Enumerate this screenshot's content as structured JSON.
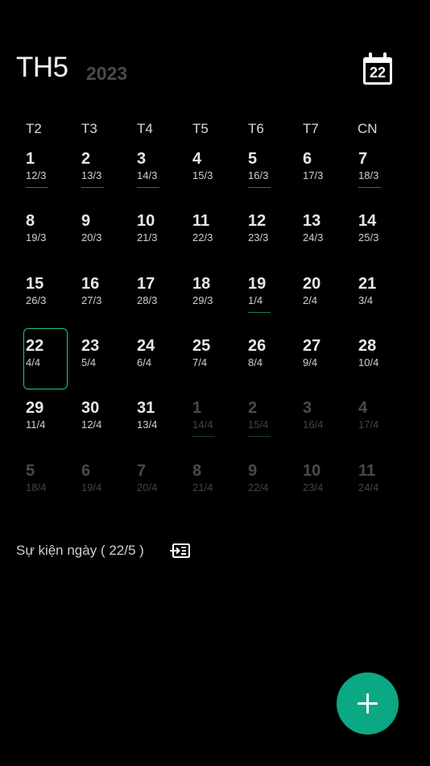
{
  "header": {
    "month": "TH5",
    "year": "2023",
    "today_icon_day": "22"
  },
  "weekdays": [
    "T2",
    "T3",
    "T4",
    "T5",
    "T6",
    "T7",
    "CN"
  ],
  "weeks": [
    [
      {
        "day": "1",
        "lunar": "12/3",
        "mark": true
      },
      {
        "day": "2",
        "lunar": "13/3",
        "mark": true
      },
      {
        "day": "3",
        "lunar": "14/3",
        "mark": true
      },
      {
        "day": "4",
        "lunar": "15/3",
        "mark": false
      },
      {
        "day": "5",
        "lunar": "16/3",
        "mark": true
      },
      {
        "day": "6",
        "lunar": "17/3",
        "mark": false
      },
      {
        "day": "7",
        "lunar": "18/3",
        "mark": true
      }
    ],
    [
      {
        "day": "8",
        "lunar": "19/3",
        "mark": false
      },
      {
        "day": "9",
        "lunar": "20/3",
        "mark": false
      },
      {
        "day": "10",
        "lunar": "21/3",
        "mark": false
      },
      {
        "day": "11",
        "lunar": "22/3",
        "mark": false
      },
      {
        "day": "12",
        "lunar": "23/3",
        "mark": false
      },
      {
        "day": "13",
        "lunar": "24/3",
        "mark": false
      },
      {
        "day": "14",
        "lunar": "25/3",
        "mark": false
      }
    ],
    [
      {
        "day": "15",
        "lunar": "26/3",
        "mark": false
      },
      {
        "day": "16",
        "lunar": "27/3",
        "mark": false
      },
      {
        "day": "17",
        "lunar": "28/3",
        "mark": false
      },
      {
        "day": "18",
        "lunar": "29/3",
        "mark": false
      },
      {
        "day": "19",
        "lunar": "1/4",
        "mark": true
      },
      {
        "day": "20",
        "lunar": "2/4",
        "mark": false
      },
      {
        "day": "21",
        "lunar": "3/4",
        "mark": false
      }
    ],
    [
      {
        "day": "22",
        "lunar": "4/4",
        "mark": false,
        "selected": true
      },
      {
        "day": "23",
        "lunar": "5/4",
        "mark": false
      },
      {
        "day": "24",
        "lunar": "6/4",
        "mark": false
      },
      {
        "day": "25",
        "lunar": "7/4",
        "mark": false
      },
      {
        "day": "26",
        "lunar": "8/4",
        "mark": false
      },
      {
        "day": "27",
        "lunar": "9/4",
        "mark": false
      },
      {
        "day": "28",
        "lunar": "10/4",
        "mark": false
      }
    ],
    [
      {
        "day": "29",
        "lunar": "11/4",
        "mark": false
      },
      {
        "day": "30",
        "lunar": "12/4",
        "mark": false
      },
      {
        "day": "31",
        "lunar": "13/4",
        "mark": false
      },
      {
        "day": "1",
        "lunar": "14/4",
        "mark": true,
        "other": true
      },
      {
        "day": "2",
        "lunar": "15/4",
        "mark": true,
        "other": true
      },
      {
        "day": "3",
        "lunar": "16/4",
        "mark": false,
        "other": true
      },
      {
        "day": "4",
        "lunar": "17/4",
        "mark": false,
        "other": true
      }
    ],
    [
      {
        "day": "5",
        "lunar": "18/4",
        "mark": false,
        "other": true
      },
      {
        "day": "6",
        "lunar": "19/4",
        "mark": false,
        "other": true
      },
      {
        "day": "7",
        "lunar": "20/4",
        "mark": false,
        "other": true
      },
      {
        "day": "8",
        "lunar": "21/4",
        "mark": false,
        "other": true
      },
      {
        "day": "9",
        "lunar": "22/4",
        "mark": false,
        "other": true
      },
      {
        "day": "10",
        "lunar": "23/4",
        "mark": false,
        "other": true
      },
      {
        "day": "11",
        "lunar": "24/4",
        "mark": false,
        "other": true
      }
    ]
  ],
  "events": {
    "label": "Sự kiện ngày ( 22/5 )"
  },
  "icons": {
    "today": "calendar-today-icon",
    "import": "import-events-icon",
    "add": "plus-icon"
  },
  "colors": {
    "background": "#000000",
    "accent": "#0aa885",
    "selected_border": "#19c59a",
    "mark": "#1d7a5f"
  }
}
